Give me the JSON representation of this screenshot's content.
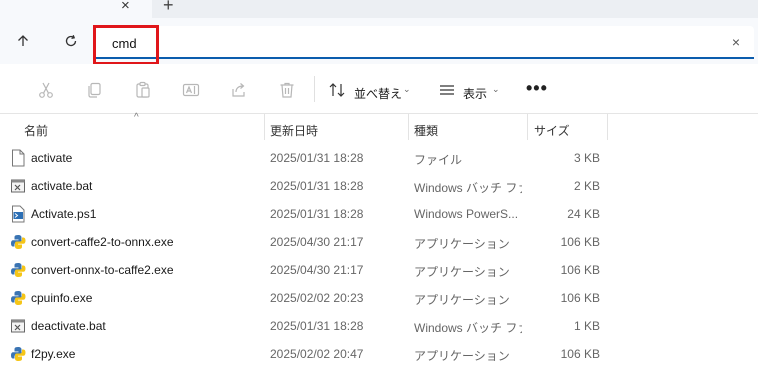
{
  "tabbar": {
    "close_glyph": "×",
    "add_glyph": "+"
  },
  "address": {
    "value": "cmd",
    "clear_glyph": "×"
  },
  "toolbar": {
    "sort_label": "並べ替え",
    "view_label": "表示",
    "chevron": "⌄",
    "more_glyph": "•••"
  },
  "columns": {
    "name": "名前",
    "modified": "更新日時",
    "type": "種類",
    "size": "サイズ",
    "sort_caret": "^"
  },
  "files": [
    {
      "name": "activate",
      "modified": "2025/01/31 18:28",
      "type": "ファイル",
      "size": "3 KB",
      "icon": "file-icon"
    },
    {
      "name": "activate.bat",
      "modified": "2025/01/31 18:28",
      "type": "Windows バッチ ファ...",
      "size": "2 KB",
      "icon": "batch-file-icon"
    },
    {
      "name": "Activate.ps1",
      "modified": "2025/01/31 18:28",
      "type": "Windows PowerS...",
      "size": "24 KB",
      "icon": "powershell-script-icon"
    },
    {
      "name": "convert-caffe2-to-onnx.exe",
      "modified": "2025/04/30 21:17",
      "type": "アプリケーション",
      "size": "106 KB",
      "icon": "python-exe-icon"
    },
    {
      "name": "convert-onnx-to-caffe2.exe",
      "modified": "2025/04/30 21:17",
      "type": "アプリケーション",
      "size": "106 KB",
      "icon": "python-exe-icon"
    },
    {
      "name": "cpuinfo.exe",
      "modified": "2025/02/02 20:23",
      "type": "アプリケーション",
      "size": "106 KB",
      "icon": "python-exe-icon"
    },
    {
      "name": "deactivate.bat",
      "modified": "2025/01/31 18:28",
      "type": "Windows バッチ ファ...",
      "size": "1 KB",
      "icon": "batch-file-icon"
    },
    {
      "name": "f2py.exe",
      "modified": "2025/02/02 20:47",
      "type": "アプリケーション",
      "size": "106 KB",
      "icon": "python-exe-icon"
    }
  ],
  "colors": {
    "accent": "#0b5cad",
    "highlight_box": "#e0161a",
    "python_blue": "#3a74b3",
    "python_yellow": "#f5c518"
  }
}
